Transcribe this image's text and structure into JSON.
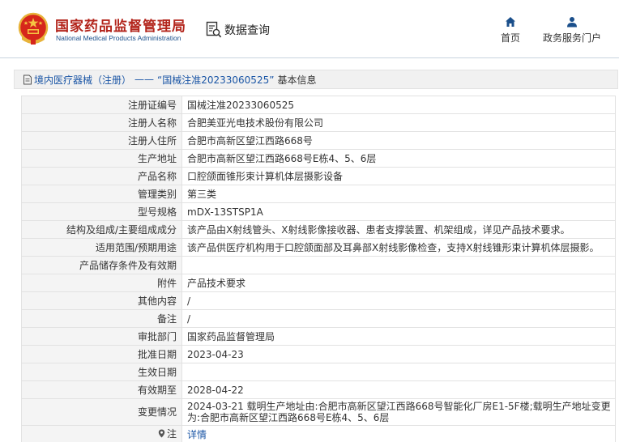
{
  "header": {
    "org_name_cn": "国家药品监督管理局",
    "org_name_en": "National Medical Products Administration",
    "query_label": "数据查询",
    "nav": {
      "home_label": "首页",
      "services_label": "政务服务门户"
    }
  },
  "breadcrumb": {
    "category": "境内医疗器械（注册）",
    "separator": "——",
    "title": "“国械注准20233060525”",
    "suffix": "基本信息"
  },
  "rows": [
    {
      "label": "注册证编号",
      "value": "国械注准20233060525"
    },
    {
      "label": "注册人名称",
      "value": "合肥美亚光电技术股份有限公司"
    },
    {
      "label": "注册人住所",
      "value": "合肥市高新区望江西路668号"
    },
    {
      "label": "生产地址",
      "value": "合肥市高新区望江西路668号E栋4、5、6层"
    },
    {
      "label": "产品名称",
      "value": "口腔颌面锥形束计算机体层摄影设备"
    },
    {
      "label": "管理类别",
      "value": "第三类"
    },
    {
      "label": "型号规格",
      "value": "mDX-13STSP1A"
    },
    {
      "label": "结构及组成/主要组成成分",
      "value": "该产品由X射线管头、X射线影像接收器、患者支撑装置、机架组成，详见产品技术要求。"
    },
    {
      "label": "适用范围/预期用途",
      "value": "该产品供医疗机构用于口腔颌面部及耳鼻部X射线影像检查，支持X射线锥形束计算机体层摄影。"
    },
    {
      "label": "产品储存条件及有效期",
      "value": ""
    },
    {
      "label": "附件",
      "value": "产品技术要求"
    },
    {
      "label": "其他内容",
      "value": "/"
    },
    {
      "label": "备注",
      "value": "/"
    },
    {
      "label": "审批部门",
      "value": "国家药品监督管理局"
    },
    {
      "label": "批准日期",
      "value": "2023-04-23"
    },
    {
      "label": "生效日期",
      "value": ""
    },
    {
      "label": "有效期至",
      "value": "2028-04-22"
    },
    {
      "label": "变更情况",
      "value": "2024-03-21 载明生产地址由:合肥市高新区望江西路668号智能化厂房E1-5F楼;载明生产地址变更为:合肥市高新区望江西路668号E栋4、5、6层"
    }
  ],
  "note_row": {
    "label": "注",
    "link": "详情"
  },
  "colors": {
    "brand_red": "#b3251c",
    "brand_blue": "#1a4f8b",
    "link_blue": "#1a55a5",
    "label_bg": "#f4f4f4",
    "border": "#e2e2e2"
  },
  "icons": {
    "emblem": "national-emblem",
    "query": "search-document-icon",
    "home": "home-icon",
    "services": "user-icon",
    "breadcrumb": "document-icon",
    "note": "location-pin-icon"
  }
}
